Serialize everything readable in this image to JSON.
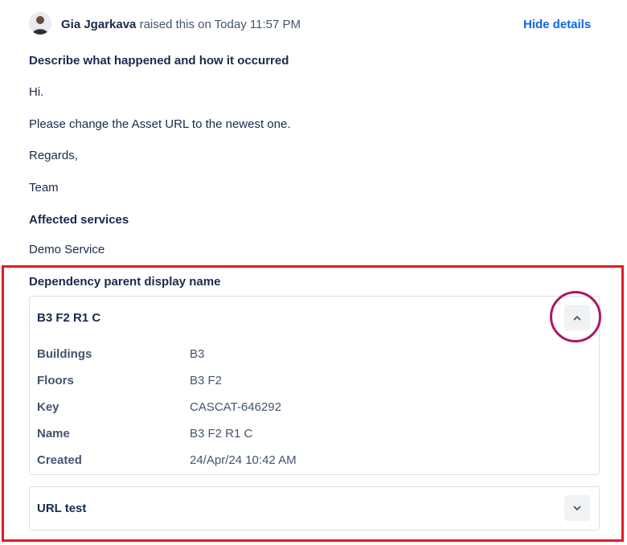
{
  "header": {
    "reporter_name": "Gia Jgarkava",
    "raised_text": " raised this on Today 11:57 PM",
    "hide_details_label": "Hide details"
  },
  "description": {
    "label": "Describe what happened and how it occurred",
    "lines": [
      "Hi.",
      "Please change the Asset URL to the newest one.",
      "Regards,",
      "Team"
    ]
  },
  "affected_services": {
    "label": "Affected services",
    "value": "Demo Service"
  },
  "dependency": {
    "label": "Dependency parent display name",
    "assets": [
      {
        "title": "B3 F2 R1 C",
        "expanded": true,
        "toggle_icon": "chevron-up-icon",
        "fields": [
          {
            "label": "Buildings",
            "value": "B3"
          },
          {
            "label": "Floors",
            "value": "B3 F2"
          },
          {
            "label": "Key",
            "value": "CASCAT-646292"
          },
          {
            "label": "Name",
            "value": "B3 F2 R1 C"
          },
          {
            "label": "Created",
            "value": "24/Apr/24 10:42 AM"
          }
        ]
      },
      {
        "title": "URL test",
        "expanded": false,
        "toggle_icon": "chevron-down-icon"
      }
    ]
  },
  "colors": {
    "link": "#0c66e4",
    "highlight_frame": "#e01c24",
    "highlight_circle": "#b01562"
  }
}
